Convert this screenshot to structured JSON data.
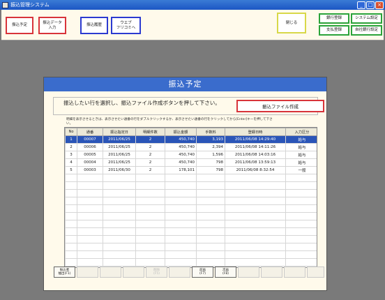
{
  "window": {
    "title": "振込管理システム"
  },
  "toolbar": {
    "schedule": "振込予定",
    "data_input": "振込データ\n入力",
    "history": "振込履歴",
    "web_furikomi": "ウエブ\nフリコミへ",
    "close": "閉じる",
    "bank_register": "銀行登録",
    "system_settings": "システム設定",
    "payee_register": "支払登録",
    "own_bank_settings": "自社銀行設定"
  },
  "modal": {
    "title": "振込予定",
    "instruction": "振込したい行を選択し、振込ファイル作成ボタンを押して下さい。",
    "create_file_button": "振込ファイル作成",
    "note": "明細を表示させるときは、表示させたい通番の行をダブルクリックするか、表示させたい通番の行をクリックしてから[Enter]キーを押して下さい。"
  },
  "table": {
    "columns": [
      "No",
      "通番",
      "振込指定日",
      "明細件数",
      "振込金額",
      "手数料",
      "登録日時",
      "入力区分"
    ],
    "rows": [
      [
        "1",
        "00007",
        "2011/06/25",
        "2",
        "450,740",
        "3,193",
        "2011/06/08 14:29:40",
        "給与"
      ],
      [
        "2",
        "00006",
        "2011/06/25",
        "2",
        "450,740",
        "2,394",
        "2011/06/08 14:11:26",
        "給与"
      ],
      [
        "3",
        "00005",
        "2011/06/25",
        "2",
        "450,740",
        "1,596",
        "2011/06/08 14:03:16",
        "給与"
      ],
      [
        "4",
        "00004",
        "2011/06/25",
        "2",
        "450,740",
        "798",
        "2011/06/08 13:59:13",
        "給与"
      ],
      [
        "5",
        "00003",
        "2011/06/30",
        "2",
        "178,101",
        "798",
        "2011/06/08 8:32:54",
        "一般"
      ]
    ],
    "selected_row": 1
  },
  "fkeys": {
    "f1": "振込者\n抽出(F1)",
    "f5": "削除\n(F5)",
    "f7": "前画\n(F7)",
    "f8": "次画\n(F8)"
  }
}
